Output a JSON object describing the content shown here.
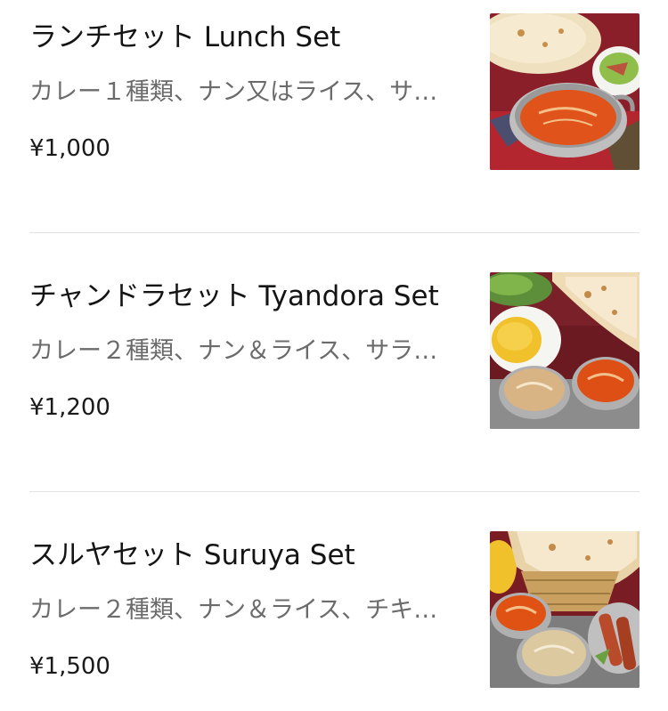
{
  "menu": {
    "items": [
      {
        "title": "ランチセット Lunch Set",
        "description": "カレー１種類、ナン又はライス、サ…",
        "price": "¥1,000"
      },
      {
        "title": "チャンドラセット Tyandora Set",
        "description": "カレー２種類、ナン＆ライス、サラ…",
        "price": "¥1,200"
      },
      {
        "title": "スルヤセット Suruya Set",
        "description": "カレー２種類、ナン＆ライス、チキ…",
        "price": "¥1,500"
      }
    ]
  },
  "colors": {
    "title_text": "#141414",
    "description_text": "#6b6b6b",
    "divider": "#e2e2e2"
  }
}
